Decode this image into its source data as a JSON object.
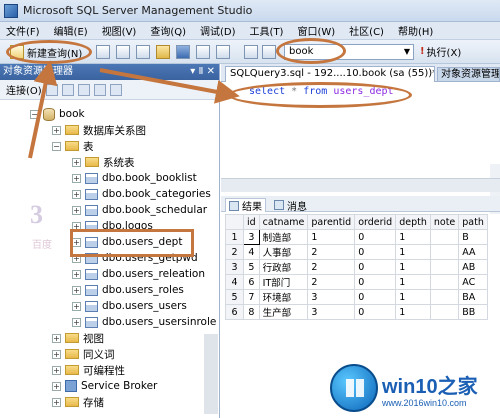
{
  "window": {
    "title": "Microsoft SQL Server Management Studio"
  },
  "menu": [
    "文件(F)",
    "编辑(E)",
    "视图(V)",
    "查询(Q)",
    "调试(D)",
    "工具(T)",
    "窗口(W)",
    "社区(C)",
    "帮助(H)"
  ],
  "toolbar": {
    "new_query": "新建查询(N)",
    "database": "book",
    "execute": "执行(X)"
  },
  "object_explorer": {
    "title": "对象资源管理器",
    "connect": "连接(O)",
    "tree": [
      {
        "label": "book",
        "type": "database",
        "expander": "−"
      },
      {
        "label": "数据库关系图",
        "type": "folder",
        "expander": "+"
      },
      {
        "label": "表",
        "type": "folder",
        "expander": "−"
      },
      {
        "label": "系统表",
        "type": "folder",
        "expander": "+"
      },
      {
        "label": "dbo.book_booklist",
        "type": "table",
        "expander": "+"
      },
      {
        "label": "dbo.book_categories",
        "type": "table",
        "expander": "+"
      },
      {
        "label": "dbo.book_schedular",
        "type": "table",
        "expander": "+"
      },
      {
        "label": "dbo.logos",
        "type": "table",
        "expander": "+"
      },
      {
        "label": "dbo.users_dept",
        "type": "table",
        "expander": "+"
      },
      {
        "label": "dbo.users_getpwd",
        "type": "table",
        "expander": "+"
      },
      {
        "label": "dbo.users_releation",
        "type": "table",
        "expander": "+"
      },
      {
        "label": "dbo.users_roles",
        "type": "table",
        "expander": "+"
      },
      {
        "label": "dbo.users_users",
        "type": "table",
        "expander": "+"
      },
      {
        "label": "dbo.users_usersinrole",
        "type": "table",
        "expander": "+"
      },
      {
        "label": "视图",
        "type": "folder",
        "expander": "+"
      },
      {
        "label": "同义词",
        "type": "folder",
        "expander": "+"
      },
      {
        "label": "可编程性",
        "type": "folder",
        "expander": "+"
      },
      {
        "label": "Service Broker",
        "type": "broker",
        "expander": "+"
      },
      {
        "label": "存储",
        "type": "folder",
        "expander": "+"
      }
    ]
  },
  "editor": {
    "active_tab": "SQLQuery3.sql - 192....10.book (sa (55))*",
    "inactive_tab": "对象资源管理",
    "sql": {
      "kw1": "select",
      "star": "*",
      "kw2": "from",
      "table": "users_dept"
    }
  },
  "results": {
    "tab_results": "结果",
    "tab_messages": "消息",
    "columns": [
      "id",
      "catname",
      "parentid",
      "orderid",
      "depth",
      "note",
      "path"
    ],
    "rows": [
      [
        "1",
        "3",
        "制造部",
        "1",
        "0",
        "1",
        "",
        "B"
      ],
      [
        "2",
        "4",
        "人事部",
        "2",
        "0",
        "1",
        "",
        "AA"
      ],
      [
        "3",
        "5",
        "行政部",
        "2",
        "0",
        "1",
        "",
        "AB"
      ],
      [
        "4",
        "6",
        "IT部门",
        "2",
        "0",
        "1",
        "",
        "AC"
      ],
      [
        "5",
        "7",
        "环境部",
        "3",
        "0",
        "1",
        "",
        "BA"
      ],
      [
        "6",
        "8",
        "生产部",
        "3",
        "0",
        "1",
        "",
        "BB"
      ]
    ]
  },
  "watermarks": {
    "left_big": "3",
    "left_small": "百度",
    "badge_title": "win10之家",
    "badge_url": "www.2016win10.com"
  },
  "colors": {
    "annotation": "#c5763e",
    "sql_keyword": "#1d3fd8",
    "sql_table": "#8b2be2",
    "header_blue": "#3a63a0"
  }
}
